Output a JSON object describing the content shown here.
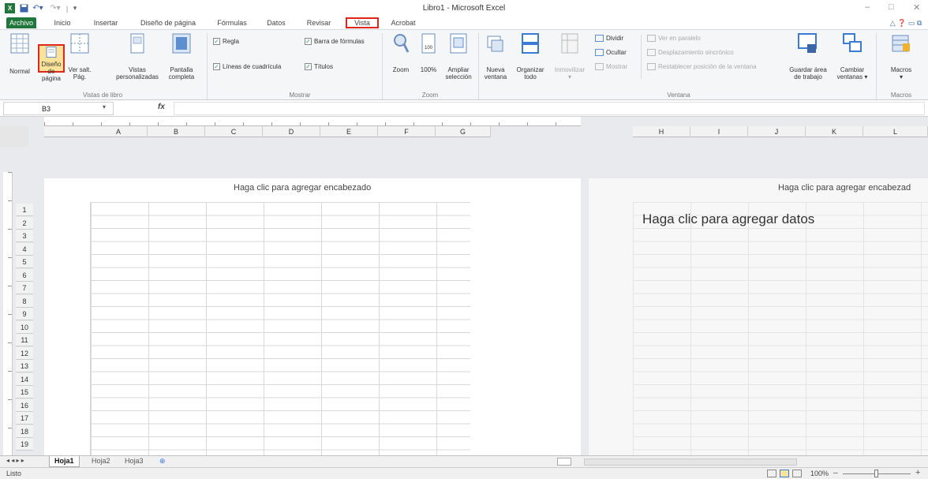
{
  "title_bar": {
    "title": "Libro1 - Microsoft Excel",
    "qa_separator": "|",
    "minimize": "–",
    "maximize": "□",
    "close": "✕"
  },
  "ribbon_tabs": [
    "Archivo",
    "Inicio",
    "Insertar",
    "Diseño de página",
    "Fórmulas",
    "Datos",
    "Revisar",
    "Vista",
    "Acrobat"
  ],
  "highlight_color": "#e0261a",
  "accent_color": "#21763c",
  "ribbon": {
    "vistas_de_libro": {
      "label": "Vistas de libro",
      "normal": "Normal",
      "diseno_l1": "Diseño",
      "diseno_l2": "de página",
      "versalt_l1": "Ver salt.",
      "versalt_l2": "Pág.",
      "vistas_l1": "Vistas",
      "vistas_l2": "personalizadas",
      "pantalla_l1": "Pantalla",
      "pantalla_l2": "completa"
    },
    "mostrar": {
      "label": "Mostrar",
      "regla": "Regla",
      "lineas": "Líneas de cuadrícula",
      "barra": "Barra de fórmulas",
      "titulos": "Títulos",
      "check": "✓"
    },
    "zoom": {
      "label": "Zoom",
      "zoom": "Zoom",
      "cien": "100%",
      "ampliar_l1": "Ampliar",
      "ampliar_l2": "selección"
    },
    "ventana": {
      "label": "Ventana",
      "nueva_l1": "Nueva",
      "nueva_l2": "ventana",
      "organizar_l1": "Organizar",
      "organizar_l2": "todo",
      "inmovilizar": "Inmovilizar",
      "dividir": "Dividir",
      "ocultar": "Ocultar",
      "mostrar": "Mostrar",
      "ver_paralelo": "Ver en paralelo",
      "desplazamiento": "Desplazamiento sincrónico",
      "restablecer": "Restablecer posición de la ventana",
      "guardar_l1": "Guardar área",
      "guardar_l2": "de trabajo",
      "cambiar_l1": "Cambiar",
      "cambiar_l2": "ventanas ▾"
    },
    "macros": {
      "label": "Macros",
      "macros": "Macros"
    }
  },
  "formula_bar": {
    "name_box": "B3",
    "fx": "fx",
    "value": ""
  },
  "columns_left": [
    "A",
    "B",
    "C",
    "D",
    "E",
    "F",
    "G"
  ],
  "columns_right": [
    "H",
    "I",
    "J",
    "K",
    "L"
  ],
  "rows": [
    "1",
    "2",
    "3",
    "4",
    "5",
    "6",
    "7",
    "8",
    "9",
    "10",
    "11",
    "12",
    "13",
    "14",
    "15",
    "16",
    "17",
    "18",
    "19"
  ],
  "page1": {
    "header_hint": "Haga clic para agregar encabezado"
  },
  "page2": {
    "header_hint": "Haga clic para agregar encabezad",
    "data_hint": "Haga clic para agregar datos"
  },
  "sheet_tabs": {
    "nav": "◂ ◂ ▸ ▸",
    "tabs": [
      "Hoja1",
      "Hoja2",
      "Hoja3"
    ]
  },
  "status_bar": {
    "status": "Listo",
    "zoom": "100%",
    "minus": "–",
    "plus": "+"
  }
}
